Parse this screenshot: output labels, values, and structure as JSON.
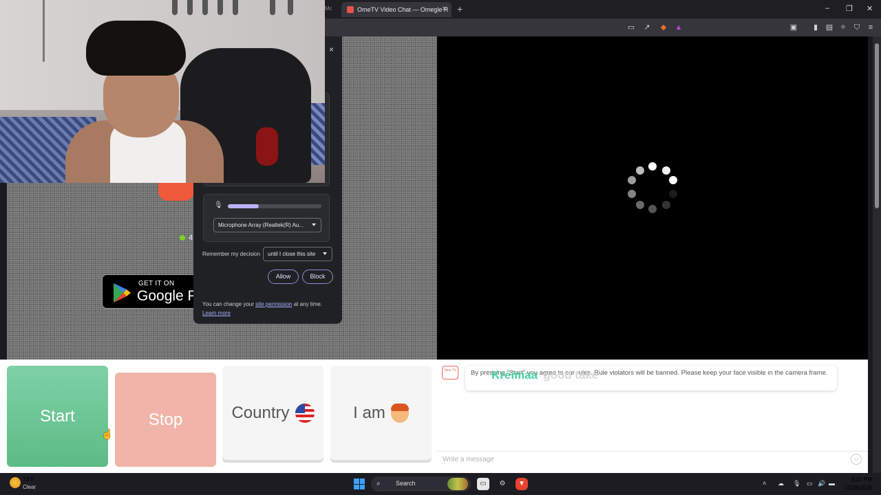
{
  "browser": {
    "prev_tab_fragment": "Mc",
    "tab_title": "OmeTV Video Chat — Omegle R",
    "new_tab": "+",
    "window_controls": [
      "–",
      "❐",
      "✕"
    ]
  },
  "site": {
    "online_indicator_color": "#7bd31d",
    "online_count_fragment": "4",
    "google_play": {
      "sub": "GET IT ON",
      "main": "Google P"
    }
  },
  "permission_popup": {
    "close": "×",
    "mic_level_percent": 33,
    "mic_device": "Microphone Array (Realtek(R) Au...",
    "remember_label": "Remember my decision",
    "remember_value": "until I close this site",
    "allow_label": "Allow",
    "block_label": "Block",
    "note_before": "You can change your ",
    "note_link": "site permission",
    "note_after": " at any time.",
    "learn_more": "Learn more"
  },
  "controls": {
    "start_label": "Start",
    "stop_label": "Stop",
    "country_label": "Country",
    "iam_label": "I am"
  },
  "chat": {
    "logo_text": "Ome TV",
    "notice": "By pressing \"Start\" you agree to our rules. Rule violators will be banned. Please keep your face visible in the camera frame.",
    "overlay_part1": "Kreimaa",
    "overlay_part2": "good take",
    "input_placeholder": "Write a message",
    "emoji": "☺"
  },
  "taskbar": {
    "weather_temp": "73°F",
    "weather_cond": "Clear",
    "search_placeholder": "Search",
    "clock_time": "8:21 PM",
    "clock_date": "12/28/2025"
  },
  "colors": {
    "start_button": "#6cc596",
    "stop_button": "#f0b5a8",
    "popup_accent": "#8a8fd8"
  }
}
